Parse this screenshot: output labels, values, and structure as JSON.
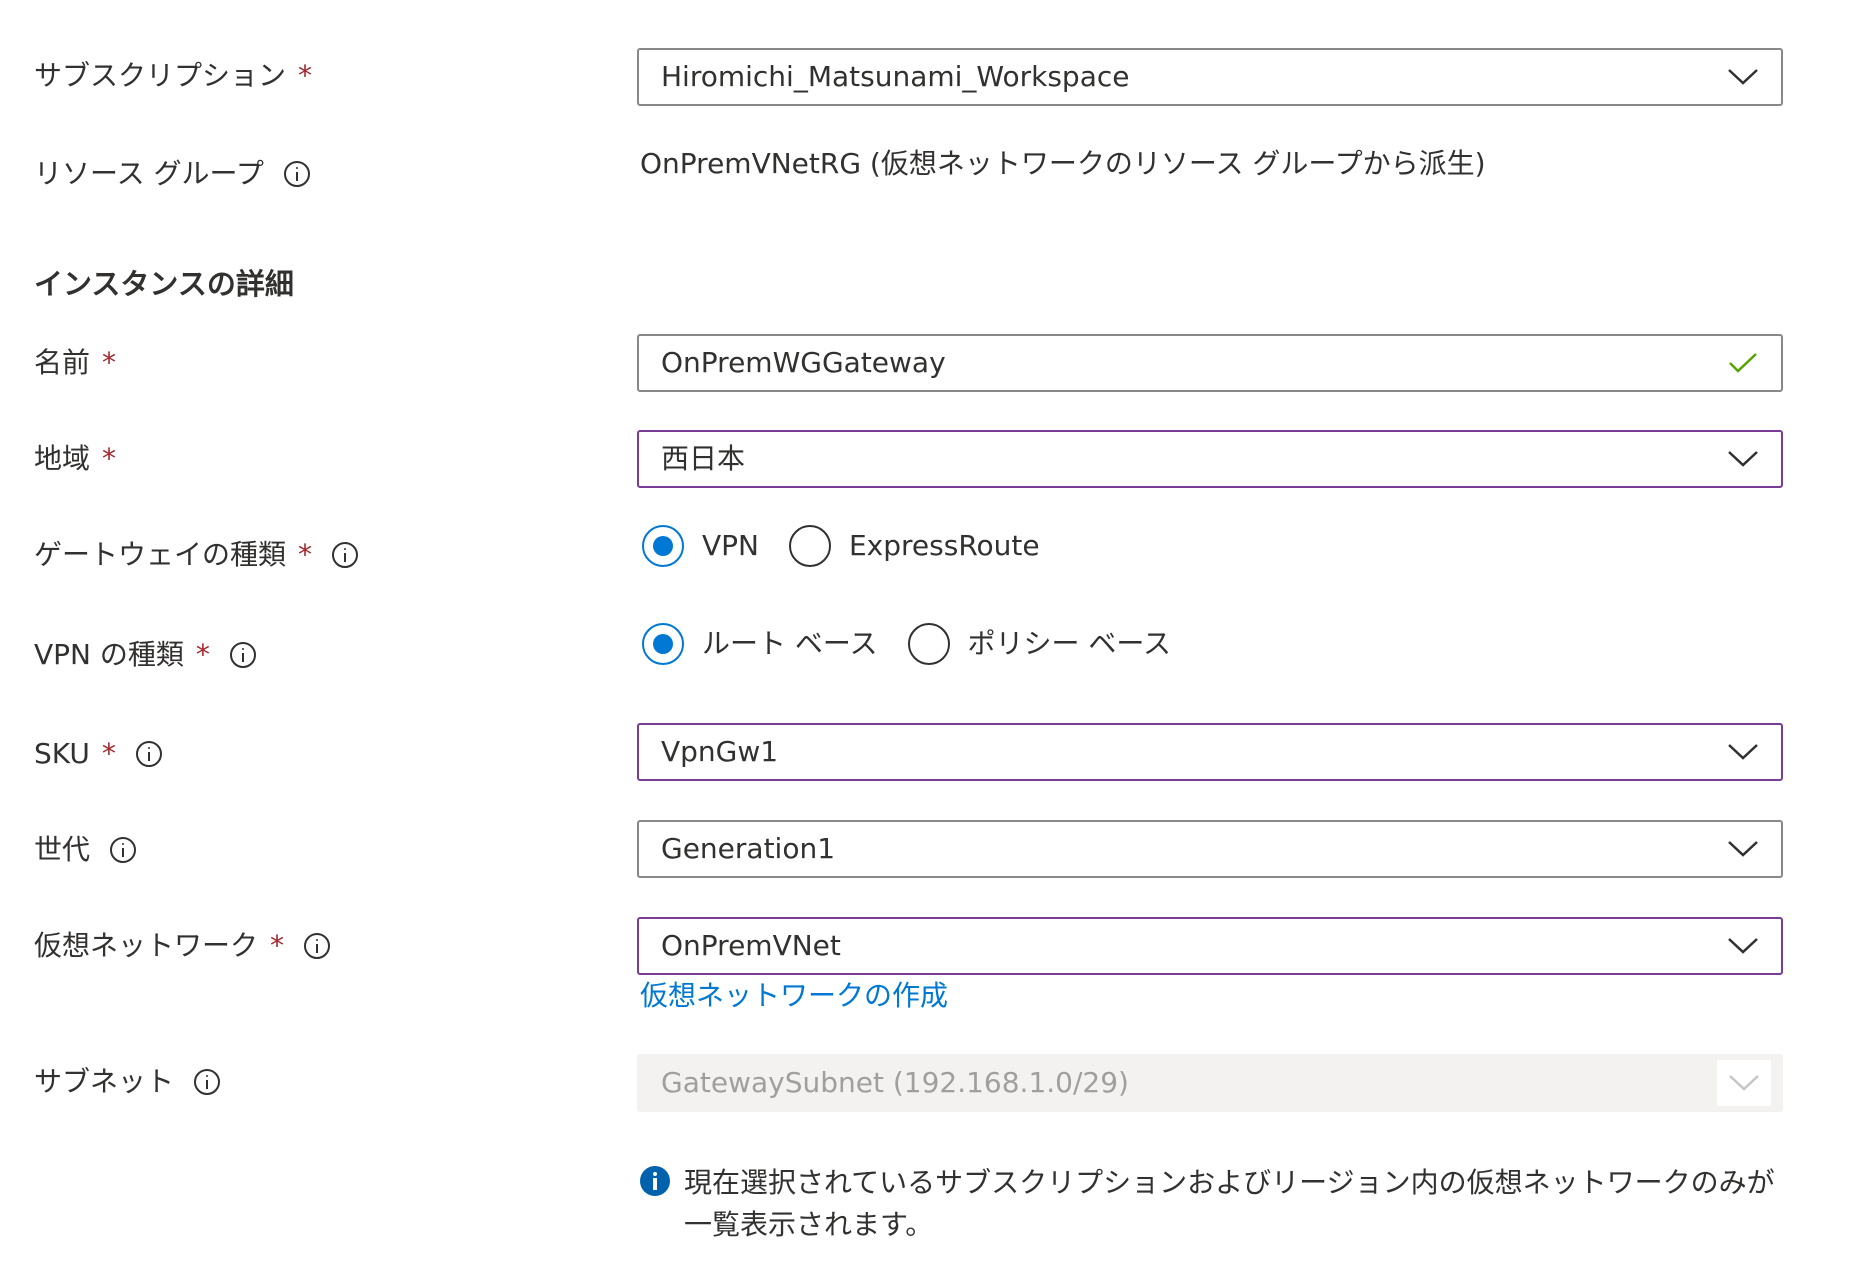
{
  "subscription": {
    "label": "サブスクリプション",
    "required_mark": "*",
    "value": "Hiromichi_Matsunami_Workspace"
  },
  "resource_group": {
    "label": "リソース グループ",
    "value": "OnPremVNetRG (仮想ネットワークのリソース グループから派生)"
  },
  "instance_details": {
    "title": "インスタンスの詳細"
  },
  "name": {
    "label": "名前",
    "required_mark": "*",
    "value": "OnPremWGGateway",
    "valid": true
  },
  "region": {
    "label": "地域",
    "required_mark": "*",
    "value": "西日本"
  },
  "gateway_type": {
    "label": "ゲートウェイの種類",
    "required_mark": "*",
    "options": [
      {
        "label": "VPN",
        "checked": true
      },
      {
        "label": "ExpressRoute",
        "checked": false
      }
    ]
  },
  "vpn_type": {
    "label": "VPN の種類",
    "required_mark": "*",
    "options": [
      {
        "label": "ルート ベース",
        "checked": true
      },
      {
        "label": "ポリシー ベース",
        "checked": false
      }
    ]
  },
  "sku": {
    "label": "SKU",
    "required_mark": "*",
    "value": "VpnGw1"
  },
  "generation": {
    "label": "世代",
    "value": "Generation1"
  },
  "virtual_network": {
    "label": "仮想ネットワーク",
    "required_mark": "*",
    "value": "OnPremVNet",
    "create_link": "仮想ネットワークの作成"
  },
  "subnet": {
    "label": "サブネット",
    "value": "GatewaySubnet (192.168.1.0/29)",
    "disabled": true
  },
  "note": {
    "text": "現在選択されているサブスクリプションおよびリージョン内の仮想ネットワークのみが一覧表示されます。"
  },
  "colors": {
    "required": "#a4262c",
    "focus_border": "#7a3d96",
    "accent": "#0078d4",
    "valid_check": "#57a300",
    "disabled_bg": "#f3f2f1"
  },
  "icons": {
    "info": "info-icon",
    "chevron": "chevron-down-icon",
    "check": "checkmark-icon",
    "note": "info-filled-icon"
  }
}
